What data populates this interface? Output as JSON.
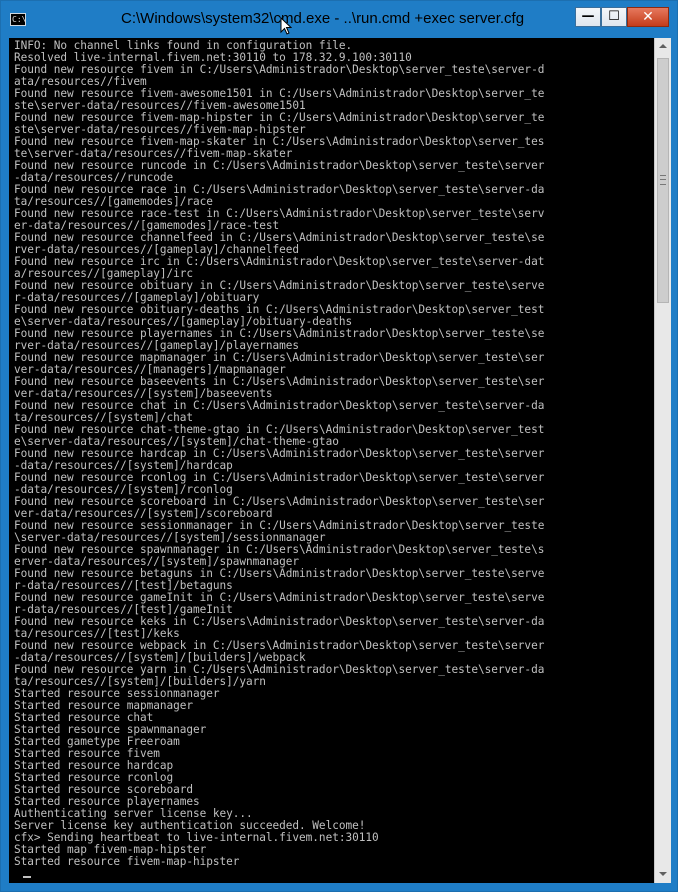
{
  "window": {
    "title": "C:\\Windows\\system32\\cmd.exe - ..\\run.cmd   +exec server.cfg",
    "icon_text": "C:\\",
    "controls": {
      "minimize_icon": "minimize-icon",
      "maximize_icon": "maximize-icon",
      "close_icon": "close-icon",
      "minimize_glyph": "—",
      "maximize_glyph": "☐",
      "close_glyph": "✕"
    }
  },
  "console": {
    "background": "#000000",
    "foreground": "#c0c0c0",
    "lines": [
      "INFO: No channel links found in configuration file.",
      "Resolved live-internal.fivem.net:30110 to 178.32.9.100:30110",
      "Found new resource fivem in C:/Users\\Administrador\\Desktop\\server_teste\\server-d",
      "ata/resources//fivem",
      "Found new resource fivem-awesome1501 in C:/Users\\Administrador\\Desktop\\server_te",
      "ste\\server-data/resources//fivem-awesome1501",
      "Found new resource fivem-map-hipster in C:/Users\\Administrador\\Desktop\\server_te",
      "ste\\server-data/resources//fivem-map-hipster",
      "Found new resource fivem-map-skater in C:/Users\\Administrador\\Desktop\\server_tes",
      "te\\server-data/resources//fivem-map-skater",
      "Found new resource runcode in C:/Users\\Administrador\\Desktop\\server_teste\\server",
      "-data/resources//runcode",
      "Found new resource race in C:/Users\\Administrador\\Desktop\\server_teste\\server-da",
      "ta/resources//[gamemodes]/race",
      "Found new resource race-test in C:/Users\\Administrador\\Desktop\\server_teste\\serv",
      "er-data/resources//[gamemodes]/race-test",
      "Found new resource channelfeed in C:/Users\\Administrador\\Desktop\\server_teste\\se",
      "rver-data/resources//[gameplay]/channelfeed",
      "Found new resource irc in C:/Users\\Administrador\\Desktop\\server_teste\\server-dat",
      "a/resources//[gameplay]/irc",
      "Found new resource obituary in C:/Users\\Administrador\\Desktop\\server_teste\\serve",
      "r-data/resources//[gameplay]/obituary",
      "Found new resource obituary-deaths in C:/Users\\Administrador\\Desktop\\server_test",
      "e\\server-data/resources//[gameplay]/obituary-deaths",
      "Found new resource playernames in C:/Users\\Administrador\\Desktop\\server_teste\\se",
      "rver-data/resources//[gameplay]/playernames",
      "Found new resource mapmanager in C:/Users\\Administrador\\Desktop\\server_teste\\ser",
      "ver-data/resources//[managers]/mapmanager",
      "Found new resource baseevents in C:/Users\\Administrador\\Desktop\\server_teste\\ser",
      "ver-data/resources//[system]/baseevents",
      "Found new resource chat in C:/Users\\Administrador\\Desktop\\server_teste\\server-da",
      "ta/resources//[system]/chat",
      "Found new resource chat-theme-gtao in C:/Users\\Administrador\\Desktop\\server_test",
      "e\\server-data/resources//[system]/chat-theme-gtao",
      "Found new resource hardcap in C:/Users\\Administrador\\Desktop\\server_teste\\server",
      "-data/resources//[system]/hardcap",
      "Found new resource rconlog in C:/Users\\Administrador\\Desktop\\server_teste\\server",
      "-data/resources//[system]/rconlog",
      "Found new resource scoreboard in C:/Users\\Administrador\\Desktop\\server_teste\\ser",
      "ver-data/resources//[system]/scoreboard",
      "Found new resource sessionmanager in C:/Users\\Administrador\\Desktop\\server_teste",
      "\\server-data/resources//[system]/sessionmanager",
      "Found new resource spawnmanager in C:/Users\\Administrador\\Desktop\\server_teste\\s",
      "erver-data/resources//[system]/spawnmanager",
      "Found new resource betaguns in C:/Users\\Administrador\\Desktop\\server_teste\\serve",
      "r-data/resources//[test]/betaguns",
      "Found new resource gameInit in C:/Users\\Administrador\\Desktop\\server_teste\\serve",
      "r-data/resources//[test]/gameInit",
      "Found new resource keks in C:/Users\\Administrador\\Desktop\\server_teste\\server-da",
      "ta/resources//[test]/keks",
      "Found new resource webpack in C:/Users\\Administrador\\Desktop\\server_teste\\server",
      "-data/resources//[system]/[builders]/webpack",
      "Found new resource yarn in C:/Users\\Administrador\\Desktop\\server_teste\\server-da",
      "ta/resources//[system]/[builders]/yarn",
      "Started resource sessionmanager",
      "Started resource mapmanager",
      "Started resource chat",
      "Started resource spawnmanager",
      "Started gametype Freeroam",
      "Started resource fivem",
      "Started resource hardcap",
      "Started resource rconlog",
      "Started resource scoreboard",
      "Started resource playernames",
      "Authenticating server license key...",
      "Server license key authentication succeeded. Welcome!",
      "cfx> Sending heartbeat to live-internal.fivem.net:30110",
      "Started map fivem-map-hipster",
      "Started resource fivem-map-hipster"
    ]
  },
  "scrollbar": {
    "up_icon": "scroll-up-arrow-icon",
    "down_icon": "scroll-down-arrow-icon",
    "position_fraction": 0.0
  }
}
